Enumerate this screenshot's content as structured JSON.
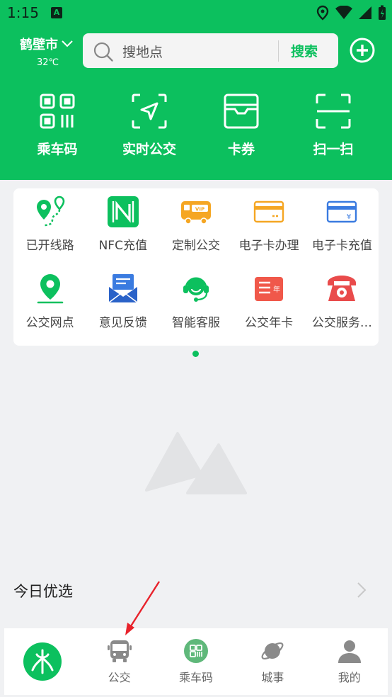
{
  "status_bar": {
    "time": "1:15",
    "indicator": "A"
  },
  "header": {
    "city": "鹤壁市",
    "temperature": "32℃",
    "search_placeholder": "搜地点",
    "search_button": "搜索",
    "quick_actions": [
      {
        "label": "乘车码",
        "icon": "qr-code-icon"
      },
      {
        "label": "实时公交",
        "icon": "realtime-bus-icon"
      },
      {
        "label": "卡券",
        "icon": "coupon-icon"
      },
      {
        "label": "扫一扫",
        "icon": "scan-icon"
      }
    ]
  },
  "services": {
    "row1": [
      {
        "label": "已开线路",
        "icon": "route-icon"
      },
      {
        "label": "NFC充值",
        "icon": "nfc-icon"
      },
      {
        "label": "定制公交",
        "icon": "vip-bus-icon"
      },
      {
        "label": "电子卡办理",
        "icon": "ecard-apply-icon"
      },
      {
        "label": "电子卡充值",
        "icon": "ecard-recharge-icon"
      }
    ],
    "row2": [
      {
        "label": "公交网点",
        "icon": "location-icon"
      },
      {
        "label": "意见反馈",
        "icon": "feedback-mail-icon"
      },
      {
        "label": "智能客服",
        "icon": "customer-service-icon"
      },
      {
        "label": "公交年卡",
        "icon": "annual-card-icon"
      },
      {
        "label": "公交服务…",
        "icon": "phone-icon"
      }
    ]
  },
  "today": {
    "title": "今日优选"
  },
  "bottom_nav": [
    {
      "label": "",
      "icon": "app-logo-icon"
    },
    {
      "label": "公交",
      "icon": "bus-icon"
    },
    {
      "label": "乘车码",
      "icon": "qr-code-icon"
    },
    {
      "label": "城事",
      "icon": "planet-icon"
    },
    {
      "label": "我的",
      "icon": "user-icon"
    }
  ],
  "colors": {
    "brand_green": "#0cc05e",
    "annotation_red": "#e8222b"
  }
}
